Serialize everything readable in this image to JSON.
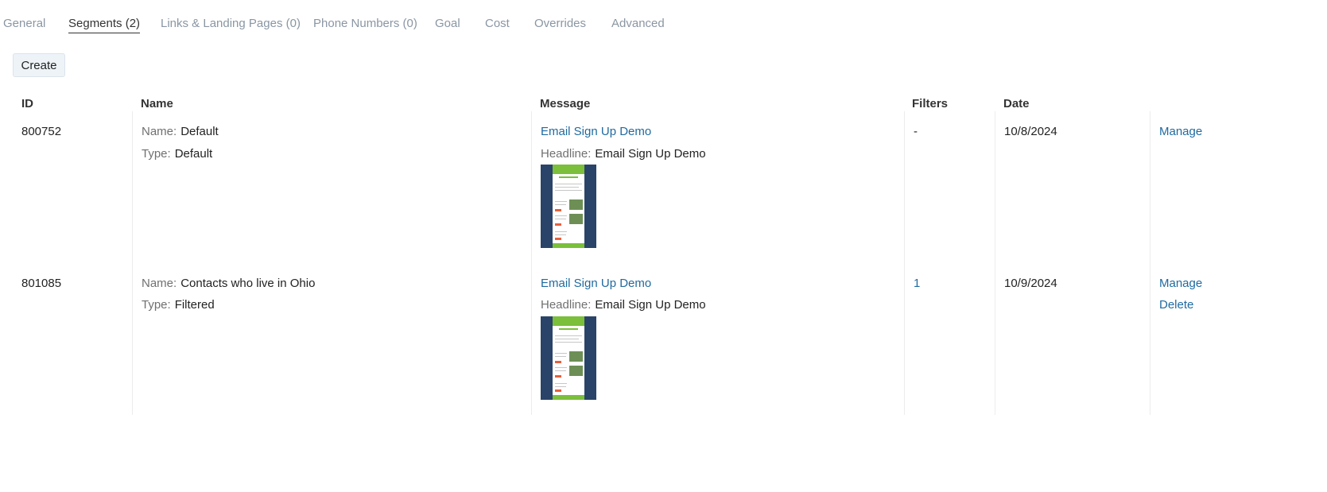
{
  "tabs": [
    {
      "label": "General"
    },
    {
      "label": "Segments (2)",
      "active": true
    },
    {
      "label": "Links & Landing Pages (0)"
    },
    {
      "label": "Phone Numbers (0)"
    },
    {
      "label": "Goal"
    },
    {
      "label": "Cost"
    },
    {
      "label": "Overrides"
    },
    {
      "label": "Advanced"
    }
  ],
  "toolbar": {
    "create_label": "Create"
  },
  "table": {
    "headers": {
      "id": "ID",
      "name": "Name",
      "message": "Message",
      "filters": "Filters",
      "date": "Date"
    },
    "labels": {
      "name": "Name:",
      "type": "Type:",
      "headline": "Headline:"
    },
    "rows": [
      {
        "id": "800752",
        "name": "Default",
        "type": "Default",
        "message_link": "Email Sign Up Demo",
        "headline": "Email Sign Up Demo",
        "filters": "-",
        "date": "10/8/2024",
        "actions": {
          "manage": "Manage"
        }
      },
      {
        "id": "801085",
        "name": "Contacts who live in Ohio",
        "type": "Filtered",
        "message_link": "Email Sign Up Demo",
        "headline": "Email Sign Up Demo",
        "filters": "1",
        "date": "10/9/2024",
        "actions": {
          "manage": "Manage",
          "delete": "Delete"
        }
      }
    ]
  },
  "colors": {
    "link": "#1f6aa0",
    "tab_inactive": "#8a96a3",
    "thumb_frame": "#2a4368",
    "thumb_accent": "#7bbf3a"
  }
}
